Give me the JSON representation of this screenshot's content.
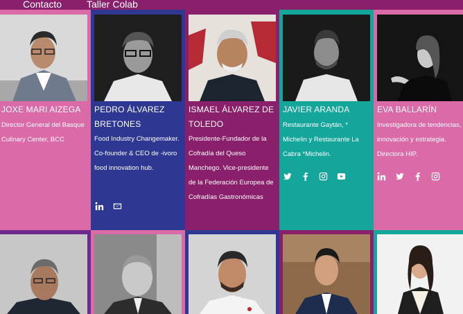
{
  "nav": {
    "contacto": "Contacto",
    "taller": "Taller Colab"
  },
  "colors": {
    "pink": "#db6aa9",
    "blue": "#2e3792",
    "magenta": "#8a1f6b",
    "teal": "#14a59b",
    "purple": "#6b2a8c"
  },
  "people": [
    {
      "name": "JOXE MARI AIZEGA",
      "desc": "Director General del Basque Culinary Center, BCC",
      "socials": []
    },
    {
      "name": "PEDRO ÁLVAREZ BRETONES",
      "desc": "Food Industry Changemaker. Co-founder & CEO de -ivoro food innovation hub.",
      "socials": [
        "linkedin-icon",
        "mail-icon"
      ]
    },
    {
      "name": "ISMAEL ÁLVAREZ DE TOLEDO",
      "desc": "Presidente-Fundador de la Cofradía del Queso Manchego. Vice-presidente de la Federación Europea de Cofradías Gastronómicas",
      "socials": []
    },
    {
      "name": "JAVIER ARANDA",
      "desc": "Restaurante Gaytán, * Michelin y Restaurante La Cabra *Michelin.",
      "socials": [
        "twitter-icon",
        "facebook-icon",
        "instagram-icon",
        "youtube-icon"
      ]
    },
    {
      "name": "EVA BALLARÍN",
      "desc": "Investigadora de tendencias, innovación y estrategia. Directora HIP.",
      "socials": [
        "linkedin-icon",
        "twitter-icon",
        "facebook-icon",
        "instagram-icon"
      ]
    }
  ]
}
